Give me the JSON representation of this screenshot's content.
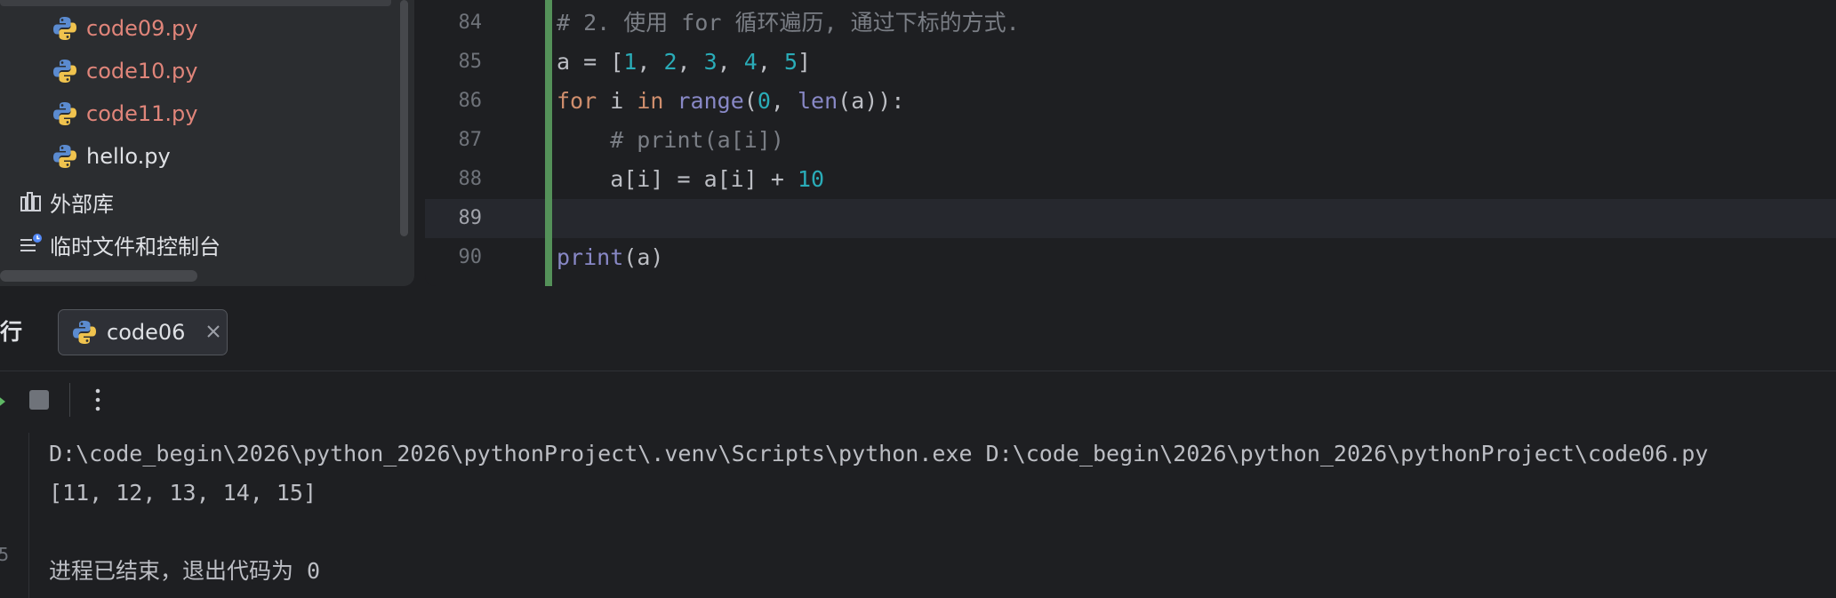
{
  "project_tree": {
    "files": [
      {
        "name": "code09.py",
        "modified": true
      },
      {
        "name": "code10.py",
        "modified": true
      },
      {
        "name": "code11.py",
        "modified": true
      },
      {
        "name": "hello.py",
        "modified": false
      }
    ],
    "external_libraries_label": "外部库",
    "scratches_label": "临时文件和控制台"
  },
  "editor": {
    "lines": [
      {
        "number": "84",
        "tokens": [
          {
            "t": "# 2. 使用 for 循环遍历, 通过下标的方式.",
            "c": "cm"
          }
        ]
      },
      {
        "number": "85",
        "tokens": [
          {
            "t": "a = [",
            "c": ""
          },
          {
            "t": "1",
            "c": "num"
          },
          {
            "t": ", ",
            "c": ""
          },
          {
            "t": "2",
            "c": "num"
          },
          {
            "t": ", ",
            "c": ""
          },
          {
            "t": "3",
            "c": "num"
          },
          {
            "t": ", ",
            "c": ""
          },
          {
            "t": "4",
            "c": "num"
          },
          {
            "t": ", ",
            "c": ""
          },
          {
            "t": "5",
            "c": "num"
          },
          {
            "t": "]",
            "c": ""
          }
        ]
      },
      {
        "number": "86",
        "tokens": [
          {
            "t": "for",
            "c": "kw"
          },
          {
            "t": " i ",
            "c": ""
          },
          {
            "t": "in",
            "c": "kw"
          },
          {
            "t": " ",
            "c": ""
          },
          {
            "t": "range",
            "c": "fn"
          },
          {
            "t": "(",
            "c": ""
          },
          {
            "t": "0",
            "c": "num"
          },
          {
            "t": ", ",
            "c": ""
          },
          {
            "t": "len",
            "c": "fn"
          },
          {
            "t": "(a)):",
            "c": ""
          }
        ]
      },
      {
        "number": "87",
        "tokens": [
          {
            "t": "    # print(a[i])",
            "c": "cm"
          }
        ]
      },
      {
        "number": "88",
        "tokens": [
          {
            "t": "    a[i] = a[i] + ",
            "c": ""
          },
          {
            "t": "10",
            "c": "num"
          }
        ]
      },
      {
        "number": "89",
        "tokens": [],
        "current": true
      },
      {
        "number": "90",
        "tokens": [
          {
            "t": "print",
            "c": "fn"
          },
          {
            "t": "(a)",
            "c": ""
          }
        ]
      }
    ]
  },
  "run_window": {
    "title": "行",
    "tab_label": "code06",
    "gutter_mark": "5",
    "console_lines": [
      "D:\\code_begin\\2026\\python_2026\\pythonProject\\.venv\\Scripts\\python.exe D:\\code_begin\\2026\\python_2026\\pythonProject\\code06.py",
      "[11, 12, 13, 14, 15]",
      "",
      "进程已结束，退出代码为 0"
    ]
  },
  "colors": {
    "modified_file": "#e0857a",
    "change_bar": "#549159",
    "keyword": "#cf8e6d",
    "builtin": "#8888c6",
    "number": "#2aacb8",
    "comment": "#7a7e85"
  },
  "icons": {
    "python_file": "python-logo-icon",
    "library": "library-icon",
    "scratches": "scratches-icon",
    "close": "close-icon",
    "rerun": "rerun-icon",
    "stop": "stop-icon",
    "more": "more-vertical-icon"
  }
}
